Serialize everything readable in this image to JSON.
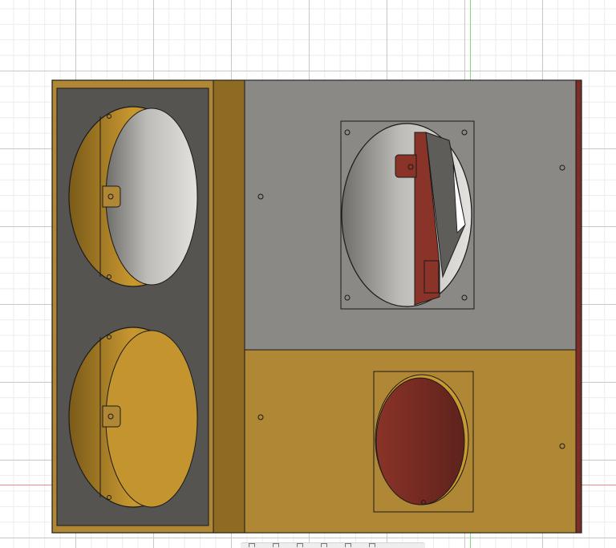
{
  "viewport": {
    "background": "#ffffff",
    "grid_major_color": "#c9c9c9",
    "grid_minor_color": "#ececec",
    "axis_y_color": "#7fdc7f",
    "axis_x_color": "#e88a8a"
  },
  "colors": {
    "wood": "#b08734",
    "wood_dark": "#8f6a22",
    "panel_dark": "#555450",
    "panel_grey": "#8a8985",
    "red_part": "#7a2e26",
    "outline": "#1a1a1a"
  },
  "nav_bar": {
    "tools": [
      "orbit-icon",
      "pan-icon",
      "zoom-icon",
      "look-icon",
      "fit-icon",
      "display-icon",
      "grid-icon"
    ]
  }
}
